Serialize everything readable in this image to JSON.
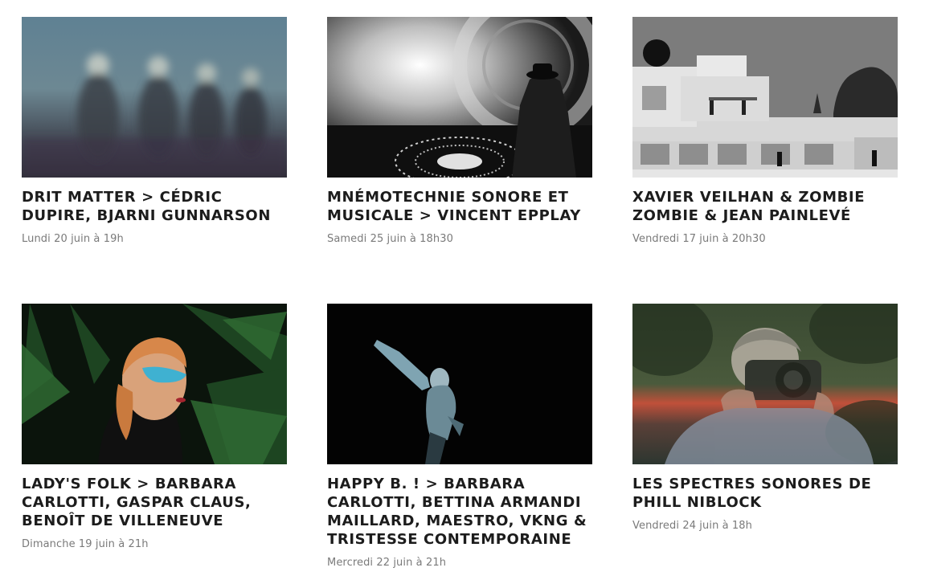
{
  "events": [
    {
      "title": "Drit Matter > Cédric Dupire, Bjarni Gunnarson",
      "date": "Lundi 20 juin à 19h",
      "image": "blurred-figures-at-night-photo"
    },
    {
      "title": "Mnémotechnie sonore et musicale > Vincent Epplay",
      "date": "Samedi 25 juin à 18h30",
      "image": "black-and-white-performer-with-projection-photo"
    },
    {
      "title": "Xavier Veilhan & Zombie Zombie & Jean Painlevé",
      "date": "Vendredi 17 juin à 20h30",
      "image": "black-and-white-modernist-villa-photo"
    },
    {
      "title": "Lady's Folk > Barbara Carlotti, Gaspar Claus, Benoît de Villeneuve",
      "date": "Dimanche 19 juin à 21h",
      "image": "woman-with-blue-face-paint-in-palm-leaves-photo"
    },
    {
      "title": "Happy B. ! > Barbara Carlotti, Bettina Armandi Maillard, Maestro, VKNG & Tristesse Contemporaine",
      "date": "Mercredi 22 juin à 21h",
      "image": "dancer-underwater-on-black-photo"
    },
    {
      "title": "Les spectres sonores de Phill Niblock",
      "date": "Vendredi 24 juin à 18h",
      "image": "man-with-camera-double-exposure-sunset-photo"
    }
  ]
}
